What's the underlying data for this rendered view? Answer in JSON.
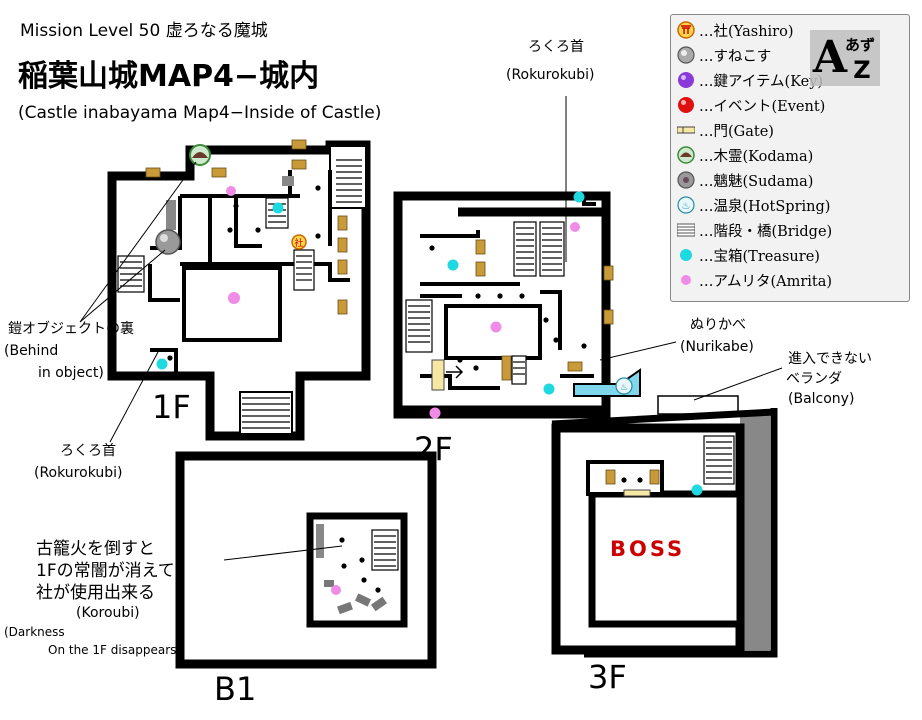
{
  "header": {
    "mission": "Mission Level 50 虚ろなる魔城",
    "title": "稲葉山城MAP4−城内",
    "subtitle": "(Castle inabayama Map4−Inside of Castle)"
  },
  "floors": {
    "f1": "1F",
    "f2": "2F",
    "f3": "3F",
    "b1": "B1"
  },
  "labels": {
    "rokurokubi_2f_jp": "ろくろ首",
    "rokurokubi_2f_en": "(Rokurokubi)",
    "armor_jp": "鎧オブジェクトの裏",
    "armor_en1": "(Behind",
    "armor_en2": "in object)",
    "rokurokubi_1f_jp": "ろくろ首",
    "rokurokubi_1f_en": "(Rokurokubi)",
    "nurikabe_jp": "ぬりかべ",
    "nurikabe_en": "(Nurikabe)",
    "balcony_jp1": "進入できない",
    "balcony_jp2": "ベランダ",
    "balcony_en": "(Balcony)",
    "koroubi_jp1": "古籠火を倒すと",
    "koroubi_jp2": "1Fの常闇が消えて",
    "koroubi_jp3": "社が使用出来る",
    "koroubi_en": "(Koroubi)",
    "darkness_en1": "(Darkness",
    "darkness_en2": "On the 1F disappears)",
    "boss": "BOSS"
  },
  "legend": [
    {
      "icon": "shrine-icon",
      "label": "…社(Yashiro)"
    },
    {
      "icon": "sunekosuri-icon",
      "label": "…すねこす"
    },
    {
      "icon": "key-item-icon",
      "label": "…鍵アイテム(Key)"
    },
    {
      "icon": "event-icon",
      "label": "…イベント(Event)"
    },
    {
      "icon": "gate-icon",
      "label": "…門(Gate)"
    },
    {
      "icon": "kodama-icon",
      "label": "…木霊(Kodama)"
    },
    {
      "icon": "sudama-icon",
      "label": "…魑魅(Sudama)"
    },
    {
      "icon": "hotspring-icon",
      "label": "…温泉(HotSpring)"
    },
    {
      "icon": "bridge-icon",
      "label": "…階段・橋(Bridge)"
    },
    {
      "icon": "treasure-icon",
      "label": "…宝箱(Treasure)"
    },
    {
      "icon": "amrita-icon",
      "label": "…アムリタ(Amrita)"
    }
  ],
  "colors": {
    "treasure": "#1ed9e0",
    "amrita": "#f08ce8",
    "wall": "#000000",
    "boss_text": "#cc0000",
    "furniture": "#c89a3a",
    "legend_bg": "#f2f2f2"
  },
  "logo": {
    "text": "Aあず",
    "letters": "A",
    "sub": "あず Z"
  }
}
